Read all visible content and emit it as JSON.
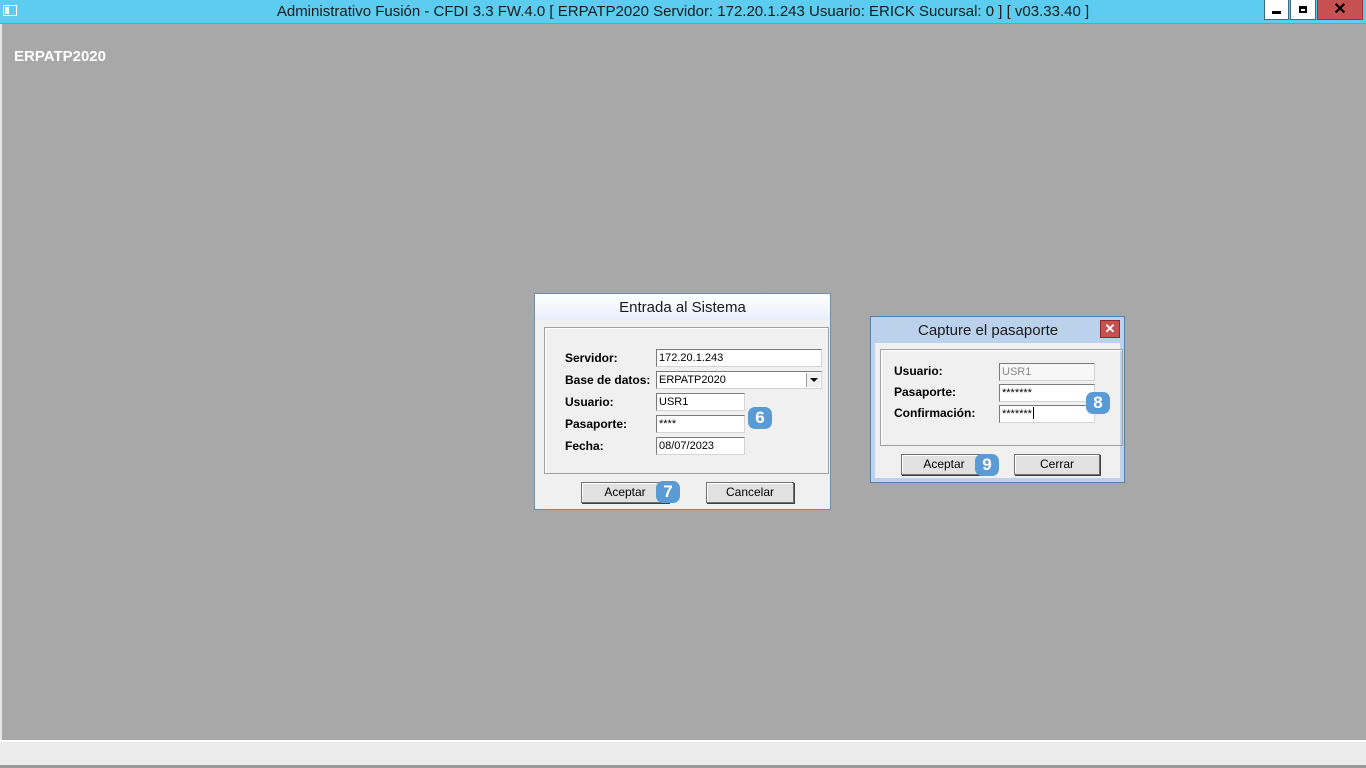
{
  "window": {
    "title": "Administrativo Fusión - CFDI 3.3 FW.4.0 [ ERPATP2020   Servidor: 172.20.1.243    Usuario: ERICK     Sucursal: 0 ] [ v03.33.40 ]",
    "controls": {
      "minimize": "minimize",
      "maximize": "restore",
      "close": "✕"
    }
  },
  "desktop": {
    "title": "ERPATP2020"
  },
  "login_dialog": {
    "title": "Entrada al Sistema",
    "servidor_label": "Servidor:",
    "servidor_value": "172.20.1.243",
    "base_label": "Base de datos:",
    "base_value": "ERPATP2020",
    "usuario_label": "Usuario:",
    "usuario_value": "USR1",
    "pasaporte_label": "Pasaporte:",
    "pasaporte_value": "****",
    "fecha_label": "Fecha:",
    "fecha_value": "08/07/2023",
    "accept_label": "Aceptar",
    "cancel_label": "Cancelar",
    "badge_6": "6",
    "badge_7": "7"
  },
  "passport_dialog": {
    "title": "Capture el pasaporte",
    "close_label": "✕",
    "usuario_label": "Usuario:",
    "usuario_value": "USR1",
    "pasaporte_label": "Pasaporte:",
    "pasaporte_value": "*******",
    "confirm_label": "Confirmación:",
    "confirm_value": "*******",
    "accept_label": "Aceptar",
    "close_button_label": "Cerrar",
    "badge_8": "8",
    "badge_9": "9"
  },
  "colors": {
    "titlebar": "#5ccdf0",
    "desktop": "#a8a8a8",
    "badge": "#5b9bd5",
    "close": "#c75050"
  }
}
